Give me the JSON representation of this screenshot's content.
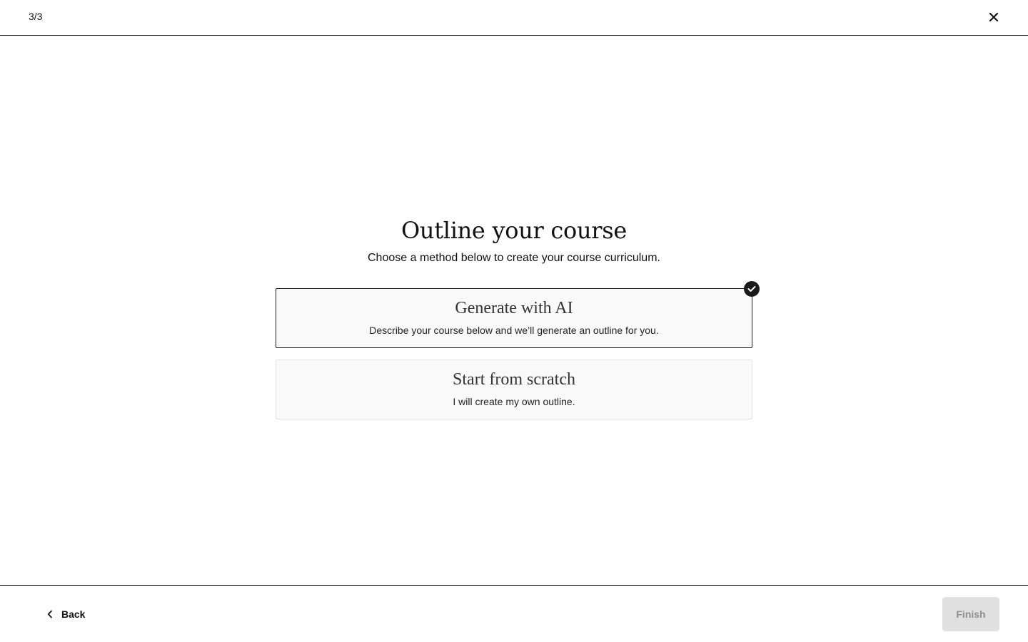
{
  "header": {
    "step_indicator": "3/3",
    "close_icon": "close-icon"
  },
  "main": {
    "title": "Outline your course",
    "subtitle": "Choose a method below to create your course curriculum.",
    "options": [
      {
        "title": "Generate with AI",
        "description": "Describe your course below and we’ll generate an outline for you.",
        "selected": true
      },
      {
        "title": "Start from scratch",
        "description": "I will create my own outline.",
        "selected": false
      }
    ],
    "selected_icon": "check-circle-icon"
  },
  "footer": {
    "back_label": "Back",
    "back_icon": "chevron-left-icon",
    "finish_label": "Finish",
    "finish_disabled": true
  },
  "colors": {
    "border_dark": "#1a1a1a",
    "card_background": "#f9f9f9",
    "card_border": "#e3e3e3",
    "button_disabled_bg": "#e0e0e0",
    "button_disabled_text": "#8f8f8f"
  }
}
